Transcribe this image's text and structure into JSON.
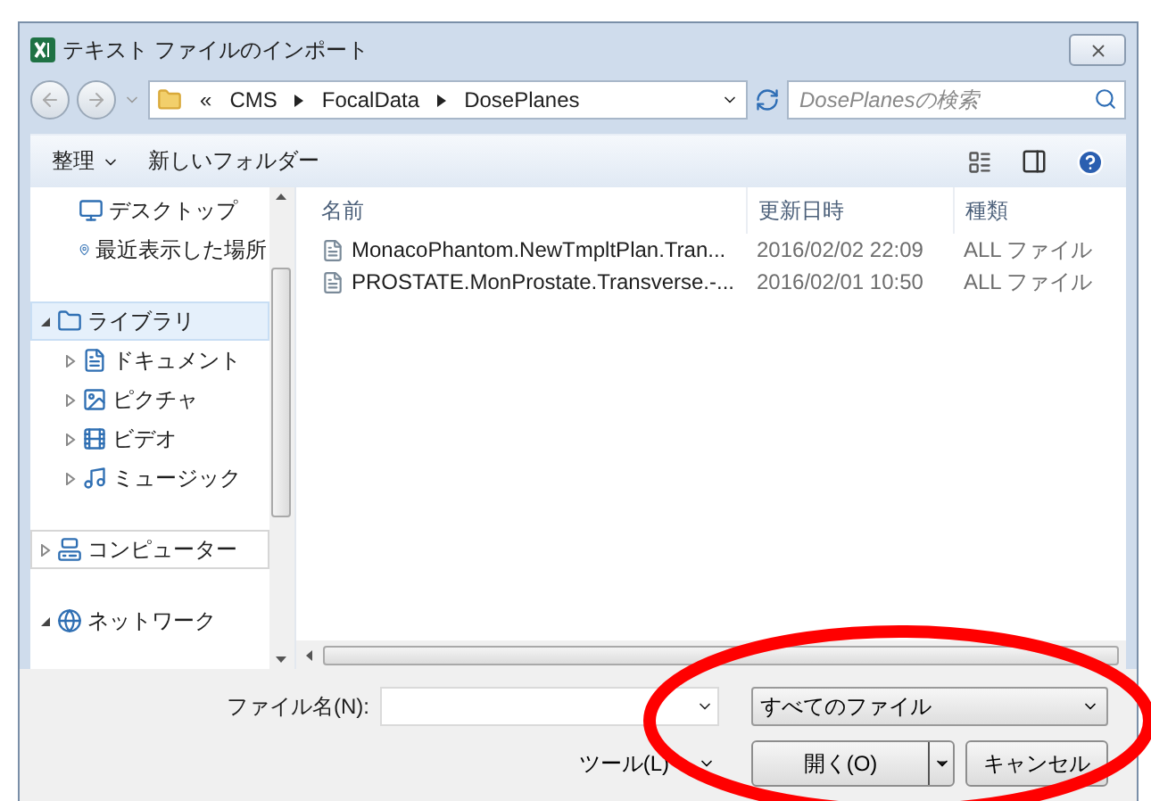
{
  "window": {
    "title": "テキスト ファイルのインポート"
  },
  "address": {
    "overflow": "«",
    "path": [
      "CMS",
      "FocalData",
      "DosePlanes"
    ]
  },
  "search": {
    "placeholder": "DosePlanesの検索"
  },
  "toolbar": {
    "organize": "整理",
    "new_folder": "新しいフォルダー"
  },
  "sidebar": {
    "groups": [
      {
        "items": [
          {
            "label": "デスクトップ",
            "selected": false
          },
          {
            "label": "最近表示した場所",
            "selected": false
          }
        ]
      },
      {
        "items": [
          {
            "label": "ライブラリ",
            "selected": true,
            "expanded": true,
            "children": [
              {
                "label": "ドキュメント",
                "selected": false,
                "expanded": false
              },
              {
                "label": "ピクチャ",
                "selected": false,
                "expanded": false
              },
              {
                "label": "ビデオ",
                "selected": false,
                "expanded": false
              },
              {
                "label": "ミュージック",
                "selected": false,
                "expanded": false
              }
            ]
          }
        ]
      },
      {
        "items": [
          {
            "label": "コンピューター",
            "selected": false,
            "hovered": true,
            "expanded": false
          }
        ]
      },
      {
        "items": [
          {
            "label": "ネットワーク",
            "selected": false,
            "expanded": true
          }
        ]
      }
    ]
  },
  "table": {
    "columns": [
      "名前",
      "更新日時",
      "種類"
    ],
    "rows": [
      [
        "MonacoPhantom.NewTmpltPlan.Tran...",
        "2016/02/02 22:09",
        "ALL ファイル"
      ],
      [
        "PROSTATE.MonProstate.Transverse.-...",
        "2016/02/01 10:50",
        "ALL ファイル"
      ]
    ]
  },
  "footer": {
    "filename_label": "ファイル名(N):",
    "file_type": "すべてのファイル",
    "tools": "ツール(L)",
    "open": "開く(O)",
    "cancel": "キャンセル"
  },
  "annotations": [
    {
      "kind": "ellipse"
    }
  ]
}
